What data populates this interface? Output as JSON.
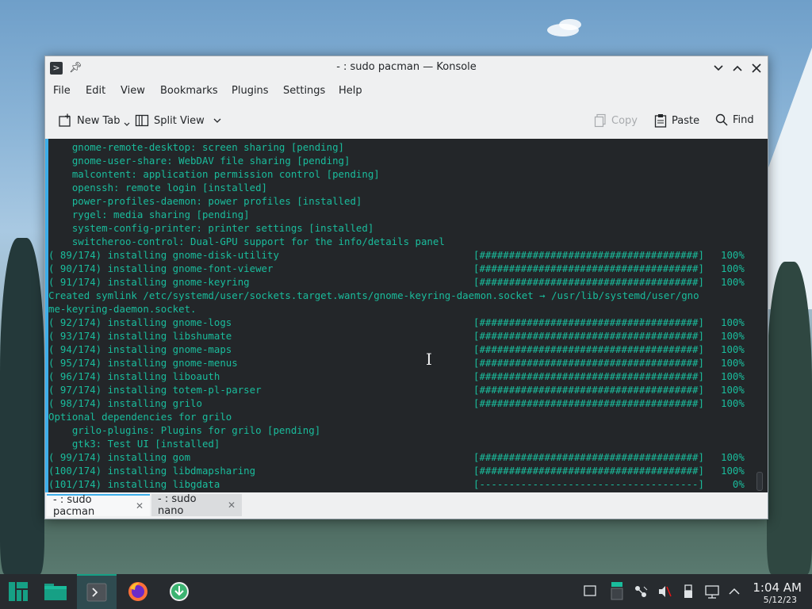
{
  "window": {
    "title": "- : sudo pacman — Konsole",
    "minimize_glyph": "⌵",
    "maximize_glyph": "⌃",
    "close_glyph": "✕"
  },
  "menubar": [
    "File",
    "Edit",
    "View",
    "Bookmarks",
    "Plugins",
    "Settings",
    "Help"
  ],
  "toolbar": {
    "new_tab": "New Tab",
    "split_view": "Split View",
    "copy": "Copy",
    "paste": "Paste",
    "find": "Find"
  },
  "terminal_lines": [
    {
      "text": "    gnome-remote-desktop: screen sharing [pending]",
      "bar": "",
      "pct": ""
    },
    {
      "text": "    gnome-user-share: WebDAV file sharing [pending]",
      "bar": "",
      "pct": ""
    },
    {
      "text": "    malcontent: application permission control [pending]",
      "bar": "",
      "pct": ""
    },
    {
      "text": "    openssh: remote login [installed]",
      "bar": "",
      "pct": ""
    },
    {
      "text": "    power-profiles-daemon: power profiles [installed]",
      "bar": "",
      "pct": ""
    },
    {
      "text": "    rygel: media sharing [pending]",
      "bar": "",
      "pct": ""
    },
    {
      "text": "    system-config-printer: printer settings [installed]",
      "bar": "",
      "pct": ""
    },
    {
      "text": "    switcheroo-control: Dual-GPU support for the info/details panel",
      "bar": "",
      "pct": ""
    },
    {
      "text": "( 89/174) installing gnome-disk-utility",
      "bar": "[#####################################]",
      "pct": "100%"
    },
    {
      "text": "( 90/174) installing gnome-font-viewer",
      "bar": "[#####################################]",
      "pct": "100%"
    },
    {
      "text": "( 91/174) installing gnome-keyring",
      "bar": "[#####################################]",
      "pct": "100%"
    },
    {
      "text": "Created symlink /etc/systemd/user/sockets.target.wants/gnome-keyring-daemon.socket → /usr/lib/systemd/user/gno",
      "bar": "",
      "pct": ""
    },
    {
      "text": "me-keyring-daemon.socket.",
      "bar": "",
      "pct": ""
    },
    {
      "text": "( 92/174) installing gnome-logs",
      "bar": "[#####################################]",
      "pct": "100%"
    },
    {
      "text": "( 93/174) installing libshumate",
      "bar": "[#####################################]",
      "pct": "100%"
    },
    {
      "text": "( 94/174) installing gnome-maps",
      "bar": "[#####################################]",
      "pct": "100%"
    },
    {
      "text": "( 95/174) installing gnome-menus",
      "bar": "[#####################################]",
      "pct": "100%"
    },
    {
      "text": "( 96/174) installing liboauth",
      "bar": "[#####################################]",
      "pct": "100%"
    },
    {
      "text": "( 97/174) installing totem-pl-parser",
      "bar": "[#####################################]",
      "pct": "100%"
    },
    {
      "text": "( 98/174) installing grilo",
      "bar": "[#####################################]",
      "pct": "100%"
    },
    {
      "text": "Optional dependencies for grilo",
      "bar": "",
      "pct": ""
    },
    {
      "text": "    grilo-plugins: Plugins for grilo [pending]",
      "bar": "",
      "pct": ""
    },
    {
      "text": "    gtk3: Test UI [installed]",
      "bar": "",
      "pct": ""
    },
    {
      "text": "( 99/174) installing gom",
      "bar": "[#####################################]",
      "pct": "100%"
    },
    {
      "text": "(100/174) installing libdmapsharing",
      "bar": "[#####################################]",
      "pct": "100%"
    },
    {
      "text": "(101/174) installing libgdata",
      "bar": "[-------------------------------------]",
      "pct": "  0%"
    }
  ],
  "tabs": [
    {
      "label": "- : sudo pacman",
      "active": true
    },
    {
      "label": "- : sudo nano",
      "active": false
    }
  ],
  "taskbar": {
    "apps": [
      "manjaro-menu-icon",
      "files-icon",
      "konsole-icon",
      "firefox-icon",
      "downloader-icon"
    ],
    "clock_time": "1:04 AM",
    "clock_date": "5/12/23"
  },
  "colors": {
    "terminal_bg": "#232629",
    "terminal_fg": "#1abc9c",
    "accent": "#3daee9",
    "taskbar_active": "#16a085"
  }
}
